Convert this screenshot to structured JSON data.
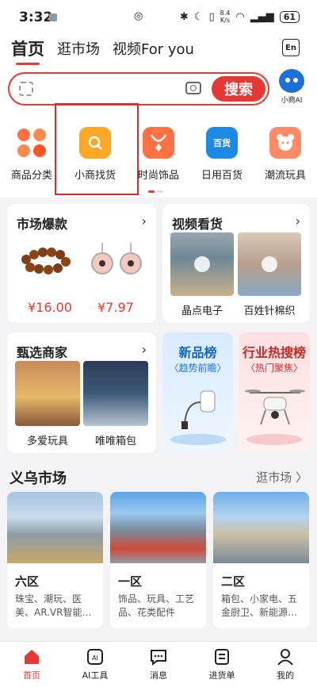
{
  "status": {
    "time": "3:32",
    "speed": "8.4\nK/s",
    "battery": "61"
  },
  "tabs": [
    {
      "label": "首页",
      "active": true
    },
    {
      "label": "逛市场",
      "active": false
    },
    {
      "label": "视频For you",
      "active": false
    }
  ],
  "lang_button": "En",
  "search": {
    "button": "搜索",
    "ai_label": "小商AI"
  },
  "categories": [
    {
      "label": "商品分类",
      "icon": "grid-flower-icon",
      "color": "#ff6b3d"
    },
    {
      "label": "小商找货",
      "icon": "shopping-bag-search-icon",
      "color": "#ffa726"
    },
    {
      "label": "时尚饰品",
      "icon": "necklace-icon",
      "color": "#ff7043"
    },
    {
      "label": "日用百货",
      "icon": "daily-goods-icon",
      "glyph": "百货",
      "color": "#1e88e5"
    },
    {
      "label": "潮流玩具",
      "icon": "teddy-bear-icon",
      "color": "#ff8a65"
    }
  ],
  "market_hot": {
    "title": "市场爆款",
    "items": [
      {
        "price": "¥16.00"
      },
      {
        "price": "¥7.97"
      }
    ]
  },
  "video": {
    "title": "视频看货",
    "items": [
      {
        "name": "晶点电子"
      },
      {
        "name": "百姓针棉织"
      }
    ]
  },
  "select_merchants": {
    "title": "甄选商家",
    "items": [
      {
        "name": "多爱玩具"
      },
      {
        "name": "唯唯箱包"
      }
    ]
  },
  "new_list": {
    "title": "新品榜",
    "subtitle": "〈趋势前瞻〉"
  },
  "hot_list": {
    "title": "行业热搜榜",
    "subtitle": "〈热门聚焦〉"
  },
  "yiwu": {
    "title": "义乌市场",
    "more": "逛市场 〉",
    "districts": [
      {
        "name": "六区",
        "desc": "珠宝、潮玩、医美、AR.VR智能…"
      },
      {
        "name": "一区",
        "desc": "饰品、玩具、工艺品、花类配件"
      },
      {
        "name": "二区",
        "desc": "箱包、小家电、五金厨卫、新能源…"
      }
    ]
  },
  "bottom_nav": [
    {
      "label": "首页",
      "active": true
    },
    {
      "label": "AI工具",
      "active": false
    },
    {
      "label": "消息",
      "active": false
    },
    {
      "label": "进货单",
      "active": false
    },
    {
      "label": "我的",
      "active": false
    }
  ]
}
